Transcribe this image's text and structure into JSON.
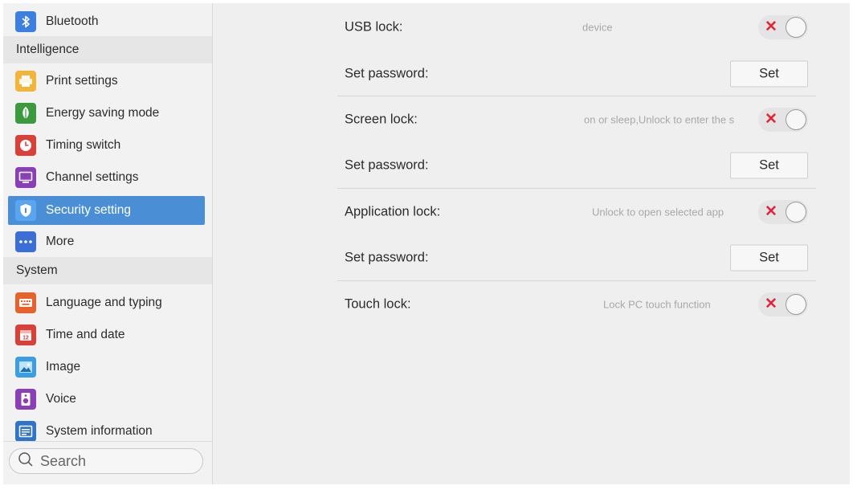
{
  "sidebar": {
    "items": [
      {
        "label": "Bluetooth",
        "icon": "bluetooth-icon"
      },
      {
        "label": "Print settings",
        "icon": "printer-icon"
      },
      {
        "label": "Energy saving mode",
        "icon": "leaf-icon"
      },
      {
        "label": "Timing switch",
        "icon": "clock-icon"
      },
      {
        "label": "Channel settings",
        "icon": "monitor-icon"
      },
      {
        "label": "Security setting",
        "icon": "shield-icon"
      },
      {
        "label": "More",
        "icon": "more-dots-icon"
      },
      {
        "label": "Language and typing",
        "icon": "keyboard-icon"
      },
      {
        "label": "Time and date",
        "icon": "calendar-icon"
      },
      {
        "label": "Image",
        "icon": "image-icon"
      },
      {
        "label": "Voice",
        "icon": "speaker-icon"
      },
      {
        "label": "System information",
        "icon": "document-icon"
      }
    ],
    "sections": [
      "Intelligence",
      "System"
    ],
    "active_index": 5,
    "search_placeholder": "Search"
  },
  "main": {
    "rows": [
      {
        "type": "toggle",
        "label": "USB lock:",
        "hint": "device",
        "enabled": false
      },
      {
        "type": "button",
        "label": "Set password:",
        "button": "Set"
      },
      {
        "type": "toggle",
        "label": "Screen lock:",
        "hint": "on or sleep,Unlock to enter the s",
        "enabled": false
      },
      {
        "type": "button",
        "label": "Set password:",
        "button": "Set"
      },
      {
        "type": "toggle",
        "label": "Application lock:",
        "hint": "Unlock to open selected app",
        "enabled": false
      },
      {
        "type": "button",
        "label": "Set password:",
        "button": "Set"
      },
      {
        "type": "toggle",
        "label": "Touch lock:",
        "hint": "Lock PC touch function",
        "enabled": false
      }
    ],
    "toggle_off_glyph": "✕"
  },
  "colors": {
    "active_item": "#4a8fd6",
    "toggle_x": "#e0243a",
    "section_bg": "#e6e6e6",
    "page_bg": "#efefef"
  }
}
